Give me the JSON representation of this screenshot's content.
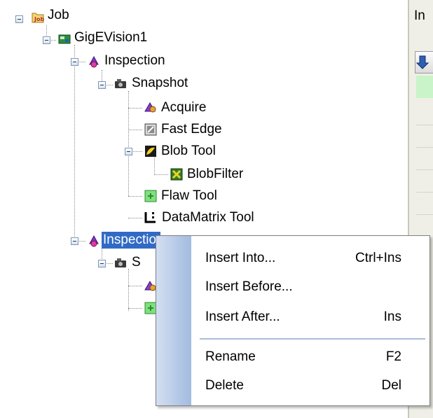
{
  "tree": {
    "job": "Job",
    "camera": "GigEVision1",
    "inspection1": "Inspection",
    "snapshot1": "Snapshot",
    "acquire": "Acquire",
    "fast_edge": "Fast Edge",
    "blob_tool": "Blob Tool",
    "blob_filter": "BlobFilter",
    "flaw_tool": "Flaw Tool",
    "datamatrix_tool": "DataMatrix Tool",
    "inspection2": "Inspection",
    "snapshot2": "S"
  },
  "right_panel": {
    "header": "In"
  },
  "context_menu": {
    "items": [
      {
        "label": "Insert Into...",
        "shortcut": "Ctrl+Ins"
      },
      {
        "label": "Insert Before...",
        "shortcut": ""
      },
      {
        "label": "Insert After...",
        "shortcut": "Ins"
      },
      {
        "label": "Rename",
        "shortcut": "F2"
      },
      {
        "label": "Delete",
        "shortcut": "Del"
      }
    ]
  },
  "colors": {
    "selection": "#316ac5",
    "menu_gutter": "#a2bbe0",
    "menu_separator": "#a8bdda",
    "right_row_highlight": "#c9f4c9"
  },
  "icons": {
    "job": "job-folder-icon",
    "camera": "camera-board-icon",
    "inspection": "inspection-tool-icon",
    "snapshot": "snapshot-camera-icon",
    "acquire": "acquire-icon",
    "fast_edge": "fast-edge-icon",
    "blob_tool": "blob-tool-icon",
    "blob_filter": "blob-filter-icon",
    "flaw_tool": "flaw-tool-icon",
    "datamatrix_tool": "datamatrix-icon"
  }
}
